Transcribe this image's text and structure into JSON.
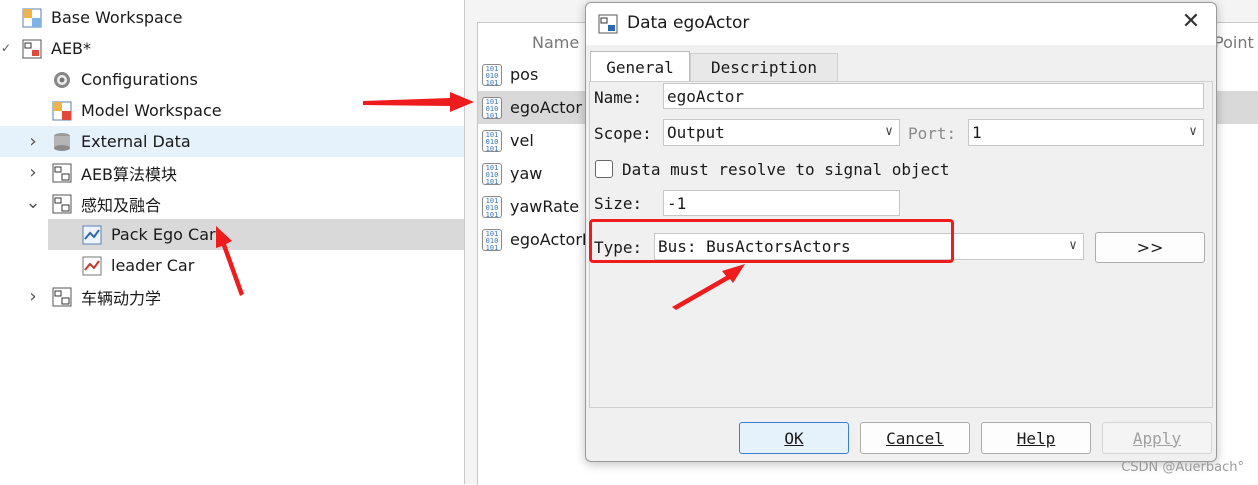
{
  "tree": {
    "items": [
      {
        "label": "Base Workspace",
        "icon": "workspace-icon"
      },
      {
        "label": "AEB*",
        "icon": "model-icon",
        "chevron": "✓"
      },
      {
        "label": "Configurations",
        "icon": "gear-icon"
      },
      {
        "label": "Model Workspace",
        "icon": "workspace-icon"
      },
      {
        "label": "External Data",
        "icon": "database-icon",
        "chevron": "›"
      },
      {
        "label": "AEB算法模块",
        "icon": "subsystem-icon",
        "chevron": "›"
      },
      {
        "label": "感知及融合",
        "icon": "subsystem-icon",
        "chevron": "⌄"
      },
      {
        "label": "Pack Ego Car",
        "icon": "chart-block-icon"
      },
      {
        "label": "leader Car",
        "icon": "chart-block-icon"
      },
      {
        "label": "车辆动力学",
        "icon": "subsystem-icon",
        "chevron": "›"
      }
    ]
  },
  "middle": {
    "columns": {
      "name": "Name",
      "point": "Point"
    },
    "rows": [
      "pos",
      "egoActor",
      "vel",
      "yaw",
      "yawRate",
      "egoActorI"
    ],
    "selected_index": 1
  },
  "dialog": {
    "title": "Data egoActor",
    "tabs": {
      "general": "General",
      "description": "Description"
    },
    "name_label": "Name:",
    "name_value": "egoActor",
    "scope_label": "Scope:",
    "scope_value": "Output",
    "port_label": "Port:",
    "port_value": "1",
    "checkbox_label": "Data must resolve to signal object",
    "size_label": "Size:",
    "size_value": "-1",
    "type_label": "Type:",
    "type_value": "Bus: BusActorsActors",
    "expand_label": ">>",
    "buttons": {
      "ok": "OK",
      "cancel": "Cancel",
      "help": "Help",
      "apply": "Apply"
    }
  },
  "watermark": "CSDN @Auerbach°",
  "colors": {
    "selection": "#d9d9d9",
    "hover": "#e5f1fb",
    "annotation_red": "#ee1c1c",
    "ok_border": "#3c7fd0"
  }
}
